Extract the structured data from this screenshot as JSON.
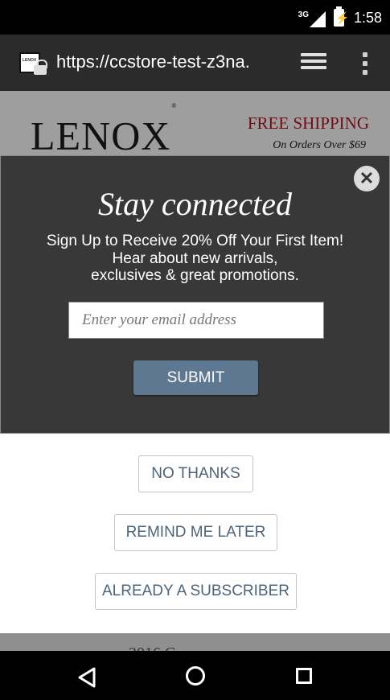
{
  "status_bar": {
    "network": "3G",
    "time": "1:58"
  },
  "browser": {
    "url": "https://ccstore-test-z3na.",
    "favicon_label": "LENOX"
  },
  "header": {
    "logo": "LENOX",
    "promo_title": "FREE SHIPPING",
    "promo_subtitle": "On Orders Over $69"
  },
  "modal": {
    "title": "Stay connected",
    "line1": "Sign Up to Receive 20% Off Your First Item!",
    "line2": "Hear about new arrivals,",
    "line3": "exclusives & great promotions.",
    "email_placeholder": "Enter your email address",
    "submit_label": "SUBMIT",
    "close_icon": "close-icon"
  },
  "options": {
    "no_thanks": "NO THANKS",
    "remind_later": "REMIND ME LATER",
    "already_subscriber": "ALREADY A SUBSCRIBER"
  },
  "footer": {
    "partial_text": "2016 C"
  },
  "colors": {
    "modal_bg": "#383838",
    "submit_bg": "#5d7890",
    "promo_red": "#6e0e12",
    "option_text": "#4e6478"
  }
}
